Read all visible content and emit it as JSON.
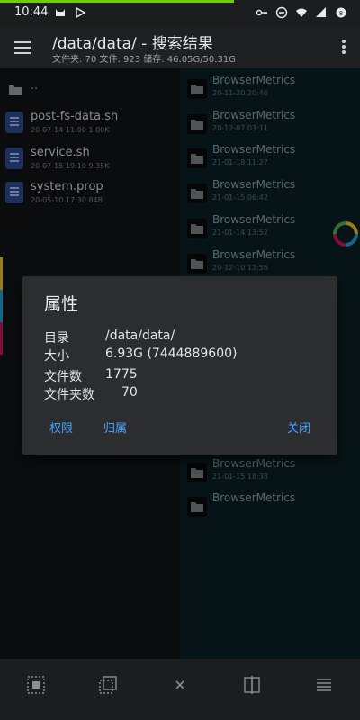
{
  "status": {
    "time": "10:44",
    "left_icons": [
      "cat-icon",
      "play-store-icon"
    ],
    "right_icons": [
      "key-icon",
      "dnd-icon",
      "wifi-icon",
      "signal-icon",
      "battery-icon"
    ]
  },
  "header": {
    "title": "/data/data/ - 搜索结果",
    "subtitle": "文件夹: 70  文件: 923  储存: 46.05G/50.31G"
  },
  "left_pane": {
    "parent_label": "..",
    "files": [
      {
        "name": "post-fs-data.sh",
        "meta": "20-07-14 11:00  1.00K"
      },
      {
        "name": "service.sh",
        "meta": "20-07-15 19:10  9.35K"
      },
      {
        "name": "system.prop",
        "meta": "20-05-10 17:30  84B"
      }
    ]
  },
  "right_pane": {
    "items": [
      {
        "name": "BrowserMetrics",
        "meta": "20-11-20 20:46"
      },
      {
        "name": "BrowserMetrics",
        "meta": "20-12-07 03:11"
      },
      {
        "name": "BrowserMetrics",
        "meta": "21-01-18 11:27"
      },
      {
        "name": "BrowserMetrics",
        "meta": "21-01-15 06:42"
      },
      {
        "name": "BrowserMetrics",
        "meta": "21-01-14 13:52"
      },
      {
        "name": "BrowserMetrics",
        "meta": "20-12-10 12:56"
      },
      {
        "name": "BrowserMetrics",
        "meta": "20-12-30 13:11"
      },
      {
        "name": "BrowserMetrics",
        "meta": "21-01-13 16:53"
      },
      {
        "name": "BrowserMetrics",
        "meta": "21-01-10 09:51"
      },
      {
        "name": "BrowserMetrics",
        "meta": "21-01-12 21:53"
      },
      {
        "name": "BrowserMetrics",
        "meta": "21-01-08 09:25"
      },
      {
        "name": "BrowserMetrics",
        "meta": "21-01-15 18:38"
      },
      {
        "name": "BrowserMetrics",
        "meta": ""
      }
    ]
  },
  "dialog": {
    "title": "属性",
    "rows": [
      {
        "label": "目录",
        "value": "/data/data/"
      },
      {
        "label": "大小",
        "value": "6.93G (7444889600)"
      },
      {
        "label": "文件数",
        "value": "1775"
      },
      {
        "label": "文件夹数",
        "value": "70"
      }
    ],
    "buttons": {
      "permissions": "权限",
      "ownership": "归属",
      "close": "关闭"
    }
  },
  "bottom_bar": {
    "icons": [
      "select-all-icon",
      "copy-icon",
      "close-icon",
      "compare-icon",
      "list-icon"
    ]
  },
  "colors": {
    "accent_blue": "#4aa3ff",
    "right_pane_bg": "#0b1f24",
    "file_icon": "#2e4a8a"
  }
}
